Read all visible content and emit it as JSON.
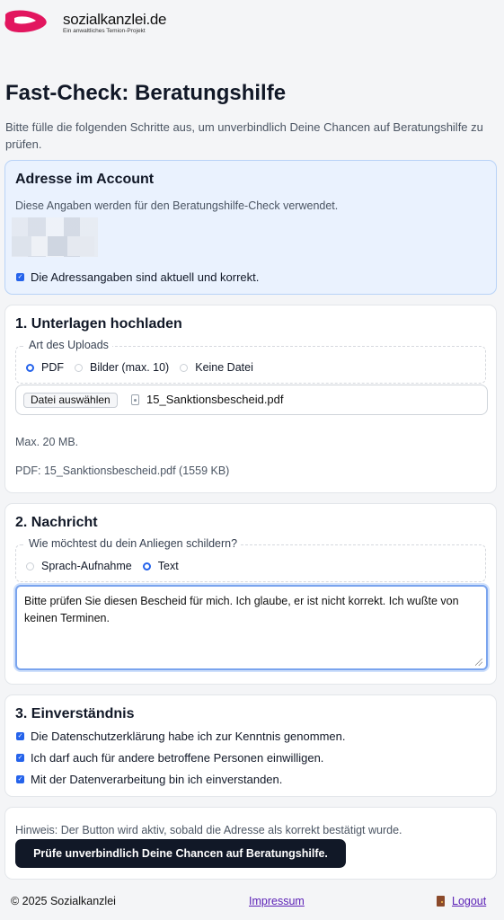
{
  "brand": {
    "name": "sozialkanzlei.de",
    "tagline": "Ein anwaltliches Temion-Projekt",
    "color": "#e2165f"
  },
  "page": {
    "title": "Fast-Check: Beratungshilfe",
    "intro": "Bitte fülle die folgenden Schritte aus, um unverbindlich Deine Chancen auf Beratungshilfe zu prüfen."
  },
  "address_card": {
    "title": "Adresse im Account",
    "description": "Diese Angaben werden für den Beratungshilfe-Check verwendet.",
    "confirm_label": "Die Adressangaben sind aktuell und korrekt.",
    "confirm_checked": true
  },
  "upload_card": {
    "title": "1. Unterlagen hochladen",
    "legend": "Art des Uploads",
    "options": [
      "PDF",
      "Bilder (max. 10)",
      "Keine Datei"
    ],
    "selected": "PDF",
    "file_button": "Datei auswählen",
    "file_name": "15_Sanktionsbescheid.pdf",
    "max_size": "Max. 20 MB.",
    "file_info": "PDF: 15_Sanktionsbescheid.pdf (1559 KB)"
  },
  "message_card": {
    "title": "2. Nachricht",
    "legend": "Wie möchtest du dein Anliegen schildern?",
    "options": [
      "Sprach-Aufnahme",
      "Text"
    ],
    "selected": "Text",
    "text": "Bitte prüfen Sie diesen Bescheid für mich. Ich glaube, er ist nicht korrekt. Ich wußte von keinen Terminen."
  },
  "consent_card": {
    "title": "3. Einverständnis",
    "items": [
      {
        "label": "Die Datenschutzerklärung habe ich zur Kenntnis genommen.",
        "checked": true
      },
      {
        "label": "Ich darf auch für andere betroffene Personen einwilligen.",
        "checked": true
      },
      {
        "label": "Mit der Datenverarbeitung bin ich einverstanden.",
        "checked": true
      }
    ]
  },
  "submit_card": {
    "hint": "Hinweis: Der Button wird aktiv, sobald die Adresse als korrekt bestätigt wurde.",
    "button": "Prüfe unverbindlich Deine Chancen auf Beratungshilfe."
  },
  "footer": {
    "copyright": "© 2025 Sozialkanzlei",
    "impressum": "Impressum",
    "logout": "Logout"
  },
  "colors": {
    "accent": "#2563eb",
    "button_bg": "#111827",
    "link": "#5b21b6",
    "address_bg": "#eaf2fe"
  }
}
